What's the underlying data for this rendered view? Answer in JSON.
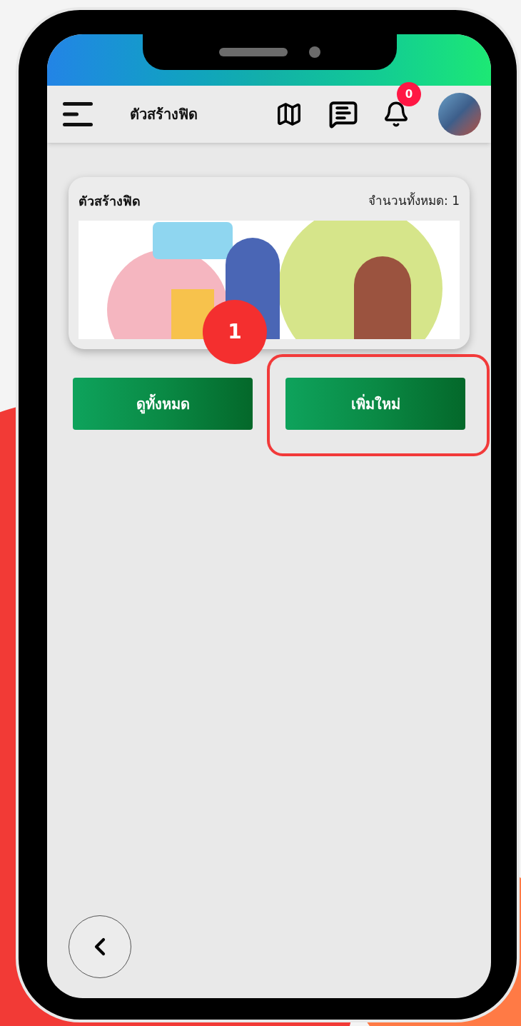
{
  "header": {
    "title": "ตัวสร้างฟิด",
    "notification_count": "0"
  },
  "card": {
    "title": "ตัวสร้างฟิด",
    "total": "จำนวนทั้งหมด: 1"
  },
  "step_badge": "1",
  "buttons": [
    {
      "label": "ดูทั้งหมด",
      "highlighted": false
    },
    {
      "label": "เพิ่มใหม่",
      "highlighted": true
    }
  ]
}
